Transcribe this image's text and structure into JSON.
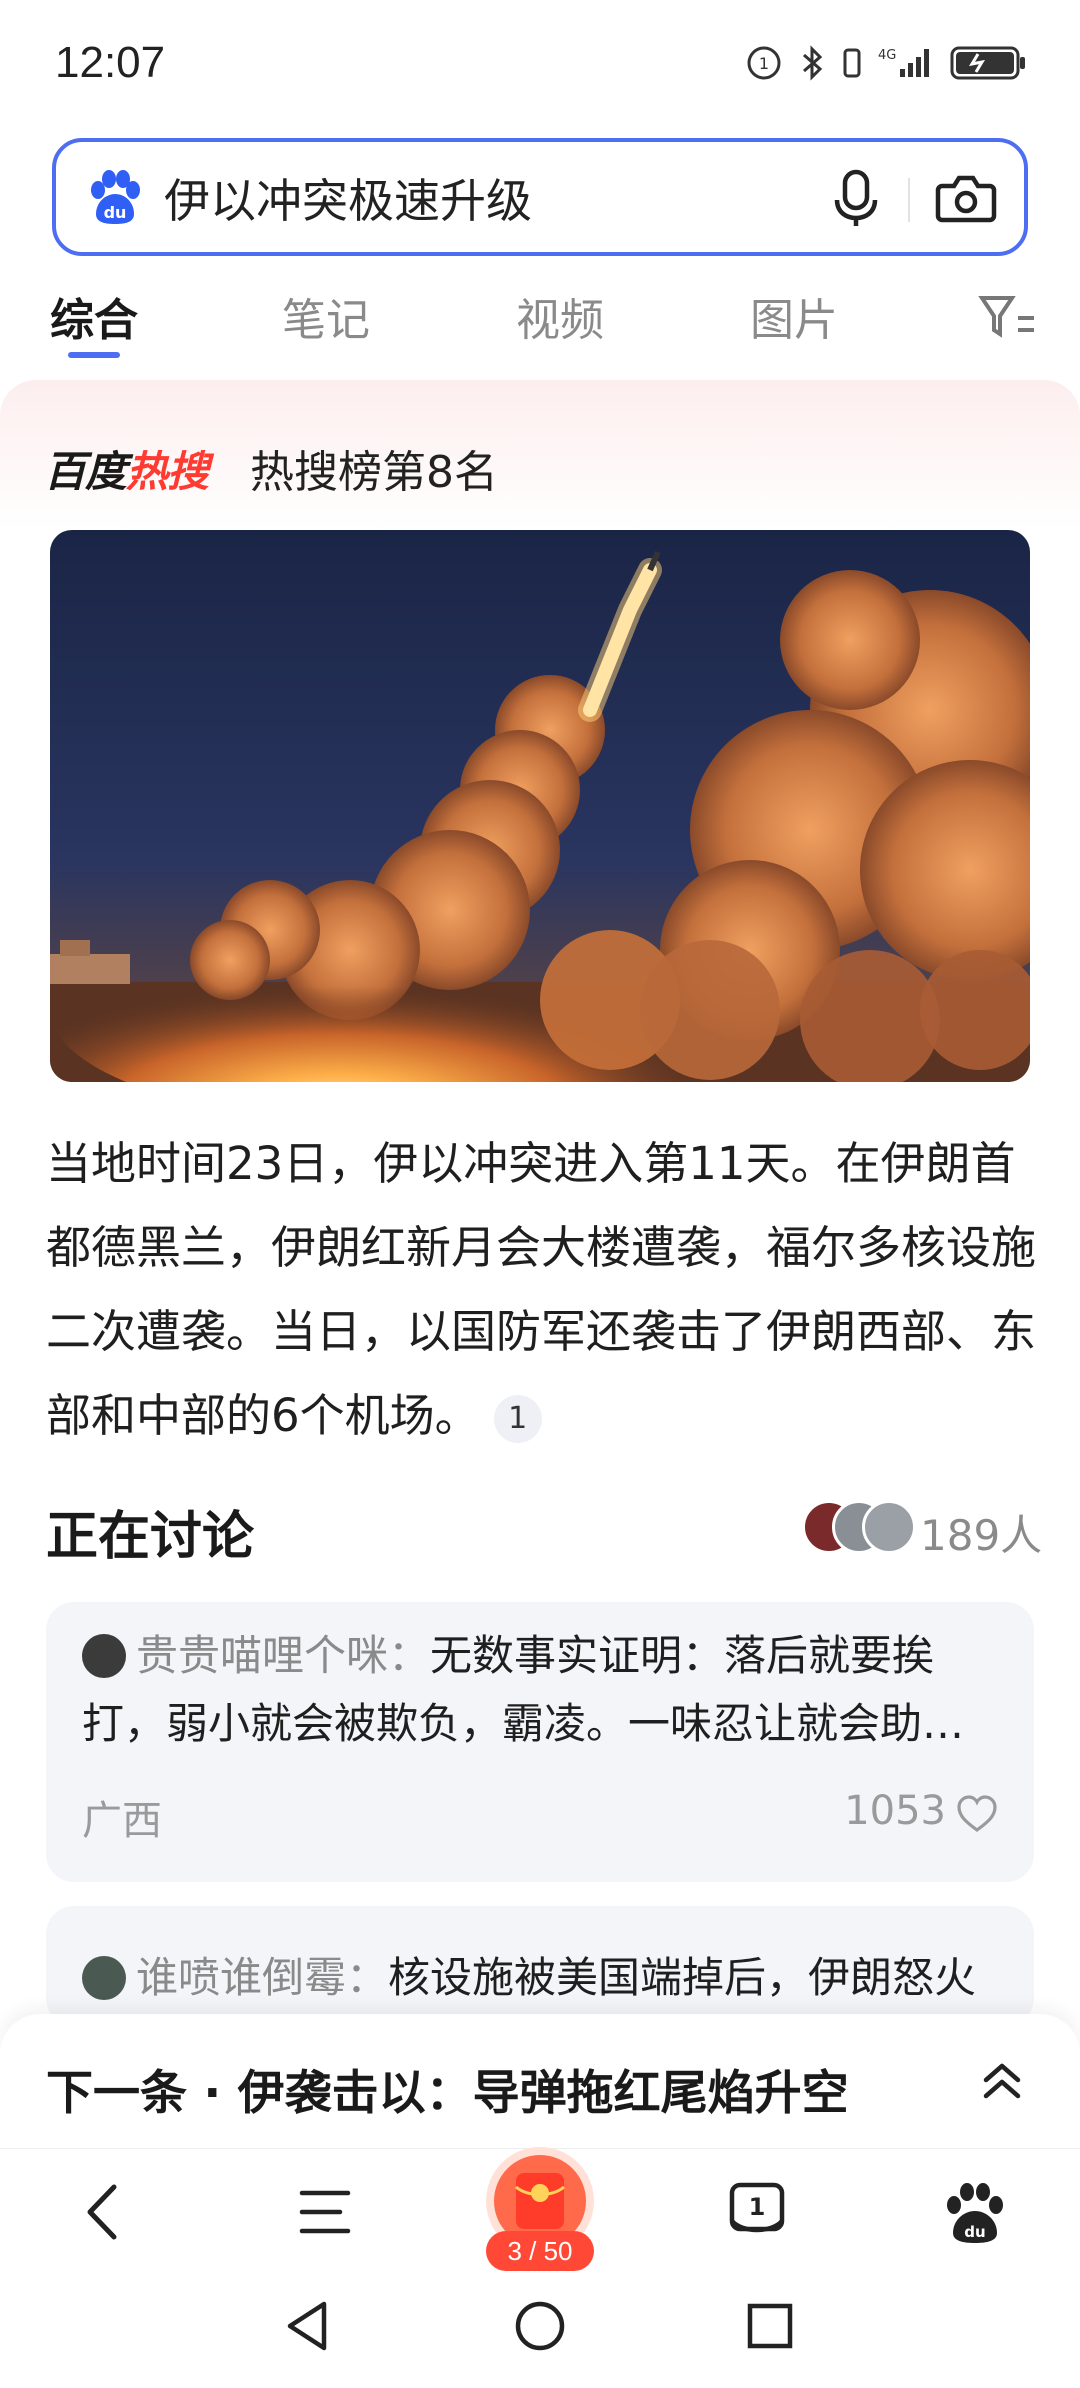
{
  "status_bar": {
    "time": "12:07",
    "network": "4G",
    "battery_state": "charging"
  },
  "search": {
    "query": "伊以冲突极速升级"
  },
  "tabs": [
    {
      "label": "综合",
      "active": true
    },
    {
      "label": "笔记",
      "active": false
    },
    {
      "label": "视频",
      "active": false
    },
    {
      "label": "图片",
      "active": false
    }
  ],
  "hot": {
    "brand_black": "百度",
    "brand_red": "热搜",
    "rank_text": "热搜榜第8名"
  },
  "article": {
    "summary": "当地时间23日，伊以冲突进入第11天。在伊朗首都德黑兰，伊朗红新月会大楼遭袭，福尔多核设施二次遭袭。当日，以国防军还袭击了伊朗西部、东部和中部的6个机场。",
    "ref_badge": "1"
  },
  "discussion": {
    "title": "正在讨论",
    "count": "189人",
    "comments": [
      {
        "author": "贵贵喵哩个咪：",
        "text": "无数事实证明：落后就要挨打，弱小就会被欺负，霸凌。一味忍让就会助…",
        "region": "广西",
        "likes": "1053"
      },
      {
        "author": "谁喷谁倒霉：",
        "text": "核设施被美国端掉后，伊朗怒火"
      }
    ]
  },
  "next": {
    "label": "下一条 · 伊袭击以：导弹拖红尾焰升空"
  },
  "bottom_nav": {
    "redpack_count": "3 / 50",
    "tab_count": "1"
  },
  "colors": {
    "accent": "#4e6ef2",
    "hot_red": "#ff3a31",
    "redpack": "#ff4936"
  },
  "icons": [
    "baidu-paw-icon",
    "mic-icon",
    "camera-icon",
    "filter-icon",
    "heart-icon",
    "chevron-up-icon",
    "back-icon",
    "menu-icon",
    "red-packet-icon",
    "tab-count-icon",
    "baidu-home-icon"
  ]
}
